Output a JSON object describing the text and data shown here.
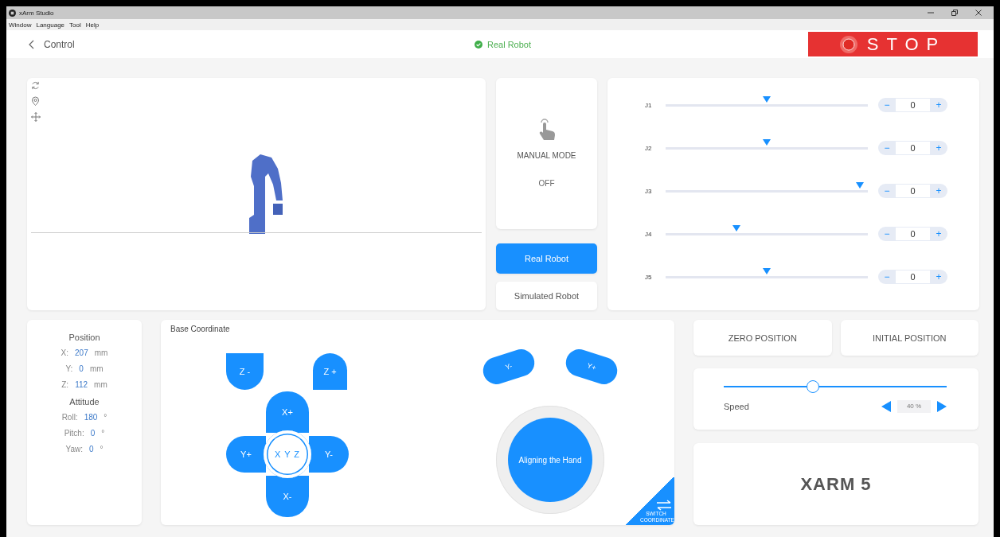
{
  "window": {
    "title": "xArm Studio"
  },
  "menu": [
    "Window",
    "Language",
    "Tool",
    "Help"
  ],
  "header": {
    "title": "Control",
    "status": "Real Robot",
    "stop": "STOP"
  },
  "manual_mode": {
    "label": "MANUAL MODE",
    "state": "OFF"
  },
  "robot_modes": [
    {
      "label": "Real Robot",
      "selected": true
    },
    {
      "label": "Simulated Robot",
      "selected": false
    }
  ],
  "joints": [
    {
      "label": "J1",
      "level": 0.5,
      "value": "0"
    },
    {
      "label": "J2",
      "level": 0.5,
      "value": "0"
    },
    {
      "label": "J3",
      "level": 0.96,
      "value": "0"
    },
    {
      "label": "J4",
      "level": 0.35,
      "value": "0"
    },
    {
      "label": "J5",
      "level": 0.5,
      "value": "0"
    }
  ],
  "stepper": {
    "minus": "−",
    "plus": "+"
  },
  "position": {
    "title": "Position",
    "rows": [
      {
        "axis": "X:",
        "value": "207",
        "unit": "mm"
      },
      {
        "axis": "Y:",
        "value": "0",
        "unit": "mm"
      },
      {
        "axis": "Z:",
        "value": "112",
        "unit": "mm"
      }
    ]
  },
  "attitude": {
    "title": "Attitude",
    "rows": [
      {
        "axis": "Roll:",
        "value": "180",
        "unit": "°"
      },
      {
        "axis": "Pitch:",
        "value": "0",
        "unit": "°"
      },
      {
        "axis": "Yaw:",
        "value": "0",
        "unit": "°"
      }
    ]
  },
  "base_coordinate": {
    "title": "Base Coordinate",
    "jog": [
      {
        "kind": "zminus",
        "label": "Z -"
      },
      {
        "kind": "zplus",
        "label": "Z +"
      },
      {
        "kind": "xplus",
        "label": "X+"
      },
      {
        "kind": "yplus",
        "label": "Y+"
      },
      {
        "kind": "center",
        "label": "X Y Z"
      },
      {
        "kind": "yminus",
        "label": "Y-"
      },
      {
        "kind": "xminus",
        "label": "X-"
      }
    ],
    "rotate": [
      {
        "label": "Y-"
      },
      {
        "label": "Y+"
      }
    ],
    "align": "Aligning the Hand",
    "switch": "SWITCH COORDINATE"
  },
  "positions": [
    "ZERO POSITION",
    "INITIAL POSITION"
  ],
  "speed": {
    "label": "Speed",
    "level": 0.4,
    "value": "40 %"
  },
  "logo": "XARM 5"
}
